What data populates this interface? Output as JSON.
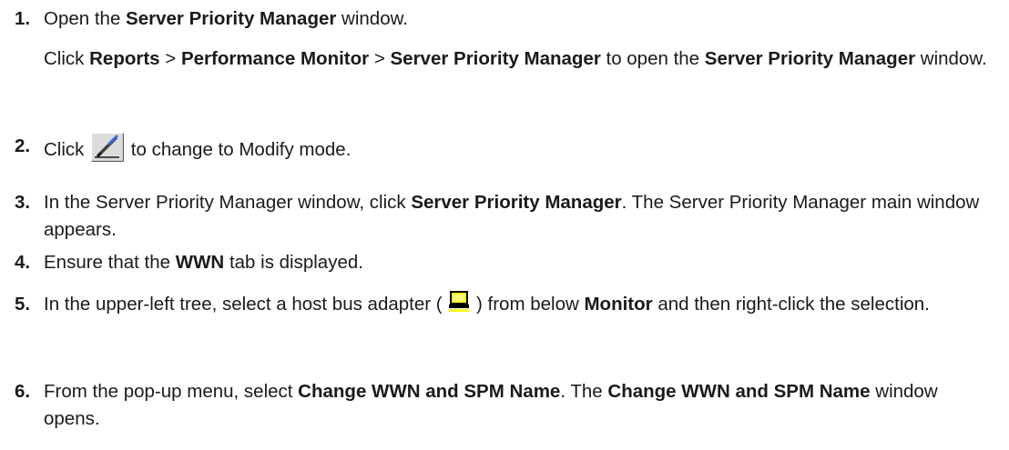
{
  "steps": [
    {
      "number": "1.",
      "segments": [
        {
          "t": "Open the ",
          "b": false
        },
        {
          "t": "Server Priority Manager",
          "b": true
        },
        {
          "t": " window.",
          "b": false
        }
      ],
      "sub": [
        {
          "t": "Click ",
          "b": false
        },
        {
          "t": "Reports",
          "b": true
        },
        {
          "t": " > ",
          "b": false
        },
        {
          "t": "Performance Monitor",
          "b": true
        },
        {
          "t": " > ",
          "b": false
        },
        {
          "t": "Server Priority Manager",
          "b": true
        },
        {
          "t": " to open the ",
          "b": false
        },
        {
          "t": "Server Priority Manager",
          "b": true
        },
        {
          "t": " window.",
          "b": false
        }
      ]
    },
    {
      "number": "2.",
      "before_icon": "Click ",
      "icon": "modify-mode-icon",
      "after_icon": " to change to Modify mode."
    },
    {
      "number": "3.",
      "segments": [
        {
          "t": "In the Server Priority Manager window, click ",
          "b": false
        },
        {
          "t": "Server Priority Manager",
          "b": true
        },
        {
          "t": ". The Server Priority Manager main window appears.",
          "b": false
        }
      ]
    },
    {
      "number": "4.",
      "segments": [
        {
          "t": "Ensure that the ",
          "b": false
        },
        {
          "t": "WWN",
          "b": true
        },
        {
          "t": " tab is displayed.",
          "b": false
        }
      ]
    },
    {
      "number": "5.",
      "before_icon": "In the upper-left tree, select a host bus adapter ( ",
      "icon": "host-bus-adapter-icon",
      "after_icon_segments": [
        {
          "t": " ) from below ",
          "b": false
        },
        {
          "t": "Monitor",
          "b": true
        },
        {
          "t": " and then right-click the selection.",
          "b": false
        }
      ]
    },
    {
      "number": "6.",
      "segments": [
        {
          "t": "From the pop-up menu, select ",
          "b": false
        },
        {
          "t": "Change WWN and SPM Name",
          "b": true
        },
        {
          "t": ". The ",
          "b": false
        },
        {
          "t": "Change WWN and SPM Name",
          "b": true
        },
        {
          "t": " window opens.",
          "b": false
        }
      ]
    }
  ]
}
